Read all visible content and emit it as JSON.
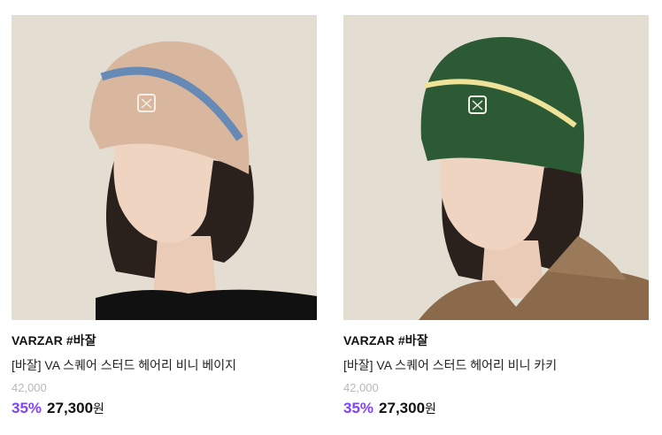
{
  "products": [
    {
      "brand": "VARZAR #바잘",
      "name": "[바잘] VA 스퀘어 스터드 헤어리 비니 베이지",
      "original_price": "42,000",
      "discount": "35%",
      "price": "27,300",
      "currency": "원",
      "image": {
        "hat_color": "#d8b79e",
        "stripe_color": "#5b84b8",
        "top_color": "#111111",
        "background": "#e8e2d7"
      }
    },
    {
      "brand": "VARZAR #바잘",
      "name": "[바잘] VA 스퀘어 스터드 헤어리 비니 카키",
      "original_price": "42,000",
      "discount": "35%",
      "price": "27,300",
      "currency": "원",
      "image": {
        "hat_color": "#2c5a34",
        "stripe_color": "#efe39a",
        "top_color": "#8a6a4a",
        "background": "#e8e3d9"
      }
    }
  ],
  "colors": {
    "discount": "#7f42ff",
    "original_price": "#b8b8b8"
  }
}
